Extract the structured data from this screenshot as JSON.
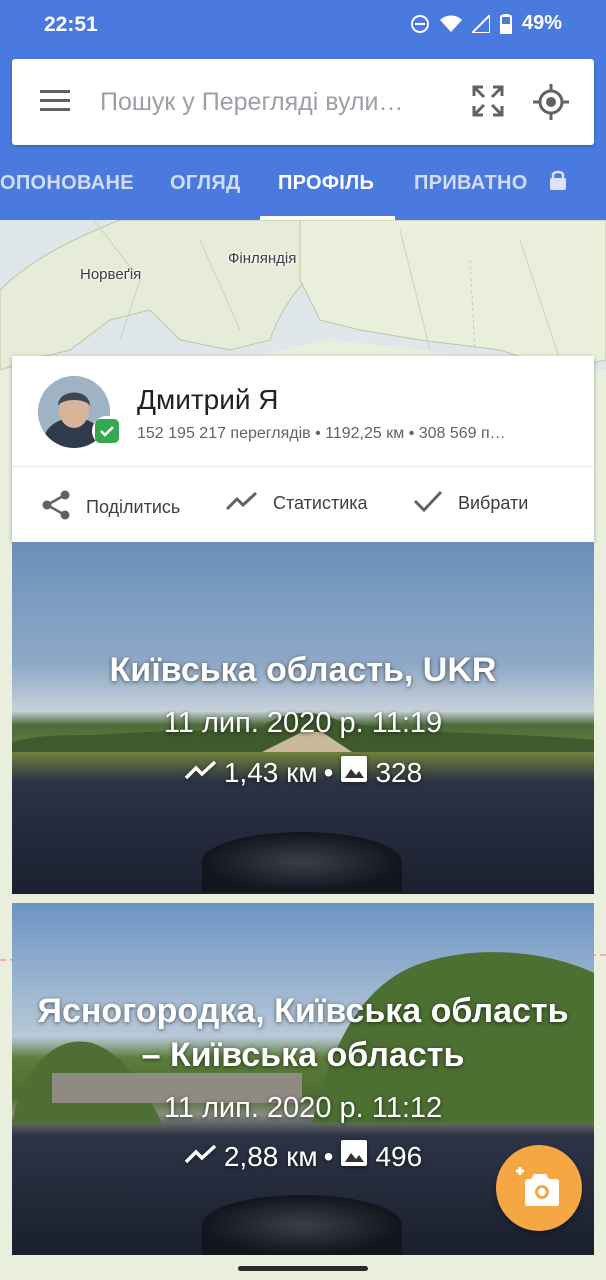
{
  "status_bar": {
    "time": "22:51",
    "battery": "49%"
  },
  "search": {
    "placeholder": "Пошук у Перегляді вули…"
  },
  "tabs": [
    {
      "label": "ОПОНОВАНЕ"
    },
    {
      "label": "ОГЛЯД"
    },
    {
      "label": "ПРОФІЛЬ",
      "active": true
    },
    {
      "label": "ПРИВАТНО"
    }
  ],
  "map": {
    "labels": [
      "Норвеґія",
      "Фінляндія"
    ]
  },
  "profile": {
    "name": "Дмитрий Я",
    "stats": "152 195 217 переглядів • 1192,25 км • 308 569 п…",
    "actions": {
      "share": "Поділитись",
      "stats": "Статистика",
      "select": "Вибрати"
    }
  },
  "collections": [
    {
      "title": "Київська область, UKR",
      "date": "11 лип. 2020 р. 11:19",
      "distance": "1,43 км",
      "photos": "328"
    },
    {
      "title": "Ясногородка, Київська область – Київська область",
      "date": "11 лип. 2020 р. 11:12",
      "distance": "2,88 км",
      "photos": "496"
    }
  ],
  "separator": "•",
  "colors": {
    "header": "#4a7ae0",
    "fab": "#f4a742",
    "verified": "#34a853"
  }
}
